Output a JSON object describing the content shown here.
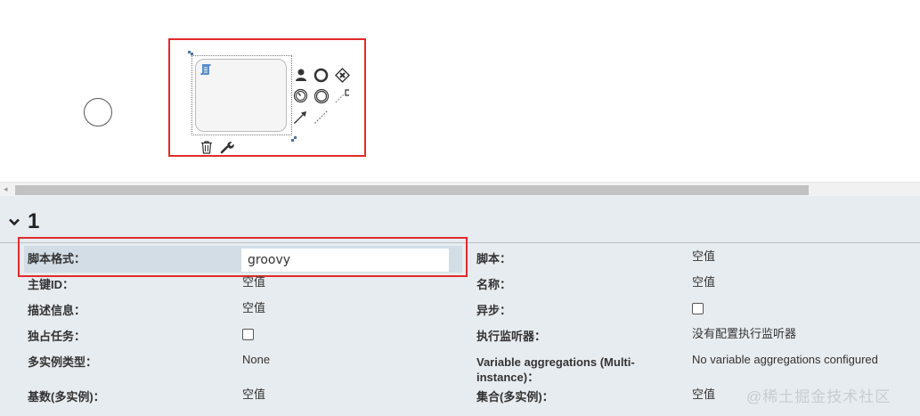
{
  "panel": {
    "title": "1"
  },
  "properties": {
    "script_format": {
      "label": "脚本格式：",
      "value": "groovy"
    },
    "script": {
      "label": "脚本：",
      "value": "空值"
    },
    "main_id": {
      "label": "主键ID：",
      "value": "空值"
    },
    "name": {
      "label": "名称：",
      "value": "空值"
    },
    "description": {
      "label": "描述信息：",
      "value": "空值"
    },
    "async": {
      "label": "异步：",
      "checked": false
    },
    "exclusive": {
      "label": "独占任务：",
      "checked": false
    },
    "execution_listeners": {
      "label": "执行监听器：",
      "value": "没有配置执行监听器"
    },
    "multi_instance_type": {
      "label": "多实例类型：",
      "value": "None"
    },
    "variable_aggregations": {
      "label": "Variable aggregations (Multi-instance)：",
      "value": "No variable aggregations configured"
    },
    "cardinality": {
      "label": "基数(多实例)：",
      "value": "空值"
    },
    "collection": {
      "label": "集合(多实例)：",
      "value": "空值"
    }
  },
  "watermark": "@稀土掘金技术社区",
  "colors": {
    "highlight": "#e02b2b",
    "panel_bg": "#e7ecf0",
    "selected_row_bg": "#d2dde6",
    "script_icon": "#5b8fc7"
  },
  "icons": [
    "user-task-icon",
    "end-event-icon",
    "gateway-icon",
    "timer-event-icon",
    "intermediate-event-icon",
    "annotation-icon",
    "sequence-flow-icon",
    "association-icon",
    "delete-icon",
    "wrench-icon",
    "script-icon",
    "chevron-down-icon"
  ]
}
